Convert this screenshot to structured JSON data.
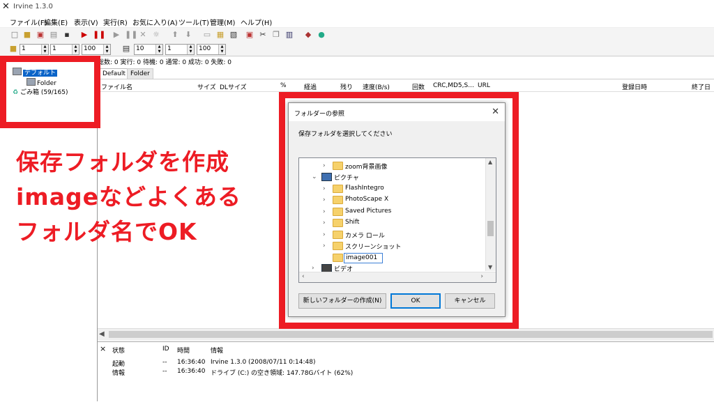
{
  "window": {
    "title": "Irvine 1.3.0"
  },
  "menu": [
    "ファイル(F)",
    "編集(E)",
    "表示(V)",
    "実行(R)",
    "お気に入り(A)",
    "ツール(T)",
    "管理(M)",
    "ヘルプ(H)"
  ],
  "spinners": [
    "1",
    "1",
    "100",
    "10",
    "1",
    "100"
  ],
  "status_line": "総数: 0  実行: 0  待機: 0  通常: 0  成功: 0  失敗: 0",
  "tree": {
    "default": "デフォルト",
    "folder": "Folder",
    "trash": "ごみ箱 (59/165)"
  },
  "tabs": [
    "Default",
    "Folder"
  ],
  "list_columns": [
    "ファイル名",
    "サイズ",
    "DLサイズ",
    "%",
    "経過",
    "残り",
    "速度(B/s)",
    "回数",
    "CRC,MD5,S...",
    "URL",
    "登録日時",
    "終了日"
  ],
  "log": {
    "close": "×",
    "headers": [
      "状態",
      "ID",
      "時間",
      "情報"
    ],
    "rows": [
      [
        "起動",
        "--",
        "16:36:40",
        "Irvine 1.3.0 (2008/07/11 0:14:48)"
      ],
      [
        "情報",
        "--",
        "16:36:40",
        "ドライブ (C:) の空き領域: 147.78Gバイト (62%)"
      ]
    ]
  },
  "annotation": {
    "lines": [
      "保存フォルダを作成",
      "imageなどよくある",
      "フォルダ名でOK"
    ],
    "color": "#ed1c24"
  },
  "dialog": {
    "title": "フォルダーの参照",
    "prompt": "保存フォルダを選択してください",
    "tree": [
      {
        "label": "zoom背景画像"
      },
      {
        "label": "ピクチャ"
      },
      {
        "label": "FlashIntegro"
      },
      {
        "label": "PhotoScape X"
      },
      {
        "label": "Saved Pictures"
      },
      {
        "label": "Shift"
      },
      {
        "label": "カメラ ロール"
      },
      {
        "label": "スクリーンショット"
      },
      {
        "label": "ビデオ"
      }
    ],
    "new_folder_name": "image001",
    "buttons": {
      "new_folder": "新しいフォルダーの作成(N)",
      "ok": "OK",
      "cancel": "キャンセル"
    }
  },
  "icons": [
    "app-logo-icon",
    "close-icon",
    "chevron-right-icon",
    "chevron-down-icon",
    "folder-icon",
    "pictures-icon",
    "video-icon",
    "trash-icon"
  ]
}
